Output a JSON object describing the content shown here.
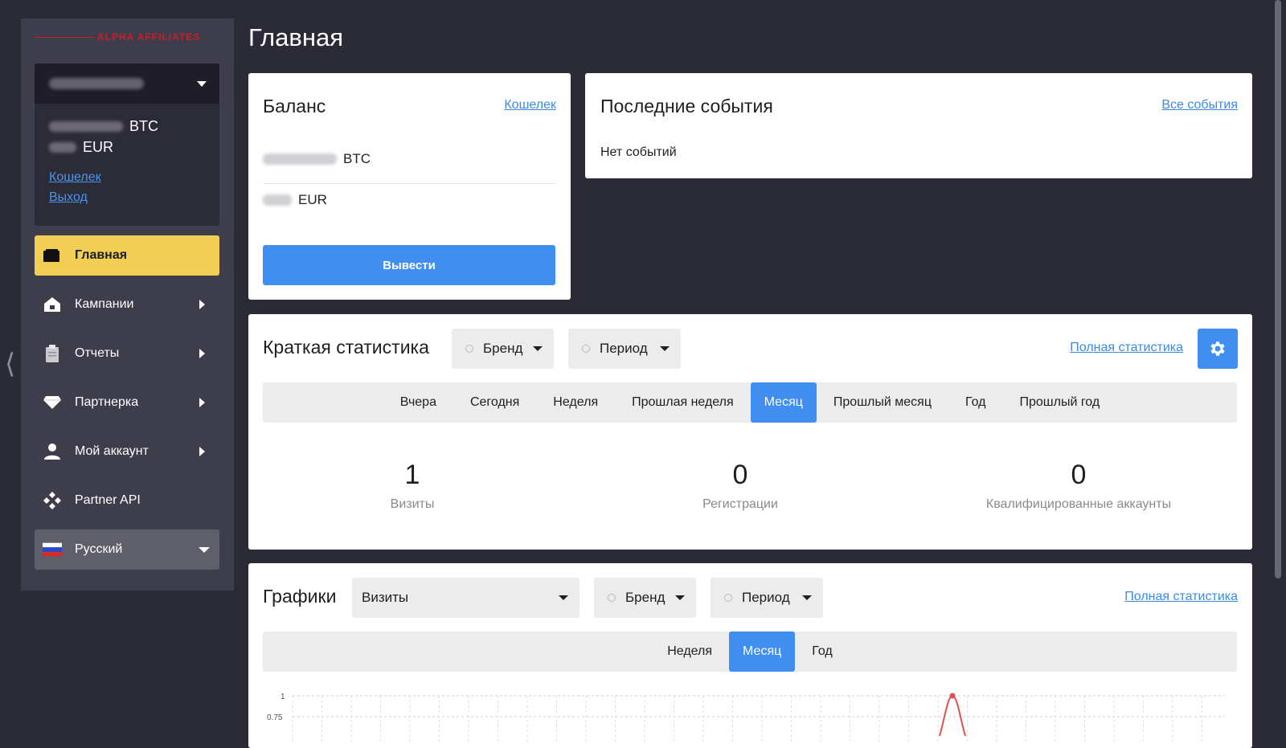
{
  "brand": {
    "logo_text": "ALPHA AFFILIATES"
  },
  "account": {
    "balances": [
      {
        "currency": "BTC"
      },
      {
        "currency": "EUR"
      }
    ],
    "links": {
      "wallet": "Кошелек",
      "logout": "Выход"
    }
  },
  "sidebar": {
    "items": [
      {
        "label": "Главная",
        "icon": "wallet-icon",
        "active": true
      },
      {
        "label": "Кампании",
        "icon": "home-icon"
      },
      {
        "label": "Отчеты",
        "icon": "clipboard-icon"
      },
      {
        "label": "Партнерка",
        "icon": "diamond-icon"
      },
      {
        "label": "Мой аккаунт",
        "icon": "user-icon"
      },
      {
        "label": "Partner API",
        "icon": "api-icon"
      }
    ],
    "language": {
      "label": "Русский",
      "icon": "russia-flag-icon"
    }
  },
  "page": {
    "title": "Главная"
  },
  "balance_card": {
    "title": "Баланс",
    "wallet_link": "Кошелек",
    "rows": [
      {
        "currency": "BTC"
      },
      {
        "currency": "EUR"
      }
    ],
    "withdraw_label": "Вывести"
  },
  "events_card": {
    "title": "Последние события",
    "all_link": "Все события",
    "empty_text": "Нет событий"
  },
  "stats_card": {
    "title": "Краткая статистика",
    "brand_select": "Бренд",
    "period_select": "Период",
    "full_link": "Полная статистика",
    "tabs": [
      {
        "label": "Вчера"
      },
      {
        "label": "Сегодня"
      },
      {
        "label": "Неделя"
      },
      {
        "label": "Прошлая неделя"
      },
      {
        "label": "Месяц",
        "active": true
      },
      {
        "label": "Прошлый месяц"
      },
      {
        "label": "Год"
      },
      {
        "label": "Прошлый год"
      }
    ],
    "stats": [
      {
        "value": "1",
        "label": "Визиты"
      },
      {
        "value": "0",
        "label": "Регистрации"
      },
      {
        "value": "0",
        "label": "Квалифицированные аккаунты"
      }
    ]
  },
  "charts_card": {
    "title": "Графики",
    "metric_select": "Визиты",
    "brand_select": "Бренд",
    "period_select": "Период",
    "full_link": "Полная статистика",
    "tabs": [
      {
        "label": "Неделя"
      },
      {
        "label": "Месяц",
        "active": true
      },
      {
        "label": "Год"
      }
    ],
    "y_ticks": [
      "1",
      "0.75"
    ]
  },
  "colors": {
    "accent": "#3f8ef0",
    "active_nav": "#f2cf54",
    "sidebar": "#3e3d4c",
    "background": "#2b2a37",
    "chart_line": "#d9534f"
  }
}
